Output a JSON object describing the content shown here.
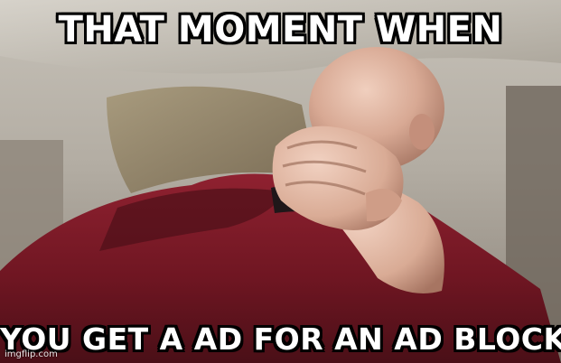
{
  "meme": {
    "top_text": "THAT MOMENT WHEN",
    "bottom_text": "YOU GET A AD FOR AN AD BLOCKER",
    "watermark": "imgflip.com"
  }
}
